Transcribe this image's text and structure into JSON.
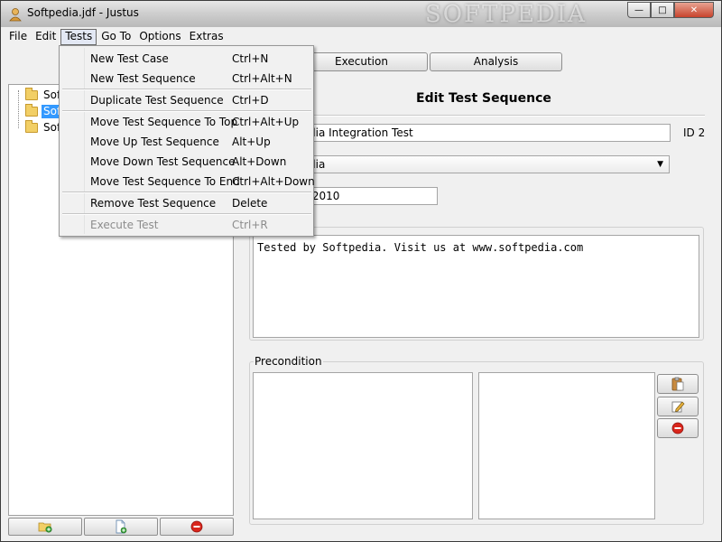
{
  "window": {
    "title": "Softpedia.jdf - Justus",
    "watermark": "SOFTPEDIA",
    "controls": {
      "minimize": "—",
      "maximize": "□",
      "close": "✕"
    }
  },
  "menubar": {
    "items": [
      "File",
      "Edit",
      "Tests",
      "Go To",
      "Options",
      "Extras"
    ],
    "active": "Tests"
  },
  "tests_menu": {
    "items": [
      {
        "label": "New Test Case",
        "shortcut": "Ctrl+N",
        "enabled": true
      },
      {
        "label": "New Test Sequence",
        "shortcut": "Ctrl+Alt+N",
        "enabled": true
      },
      {
        "label": "Duplicate Test Sequence",
        "shortcut": "Ctrl+D",
        "enabled": true
      },
      {
        "label": "Move Test Sequence To Top",
        "shortcut": "Ctrl+Alt+Up",
        "enabled": true
      },
      {
        "label": "Move Up Test Sequence",
        "shortcut": "Alt+Up",
        "enabled": true
      },
      {
        "label": "Move Down Test Sequence",
        "shortcut": "Alt+Down",
        "enabled": true
      },
      {
        "label": "Move Test Sequence To End",
        "shortcut": "Ctrl+Alt+Down",
        "enabled": true
      },
      {
        "label": "Remove Test Sequence",
        "shortcut": "Delete",
        "enabled": true
      },
      {
        "label": "Execute Test",
        "shortcut": "Ctrl+R",
        "enabled": false
      }
    ]
  },
  "tree": {
    "items": [
      {
        "label": "Sof",
        "selected": false
      },
      {
        "label": "Sof",
        "selected": true
      },
      {
        "label": "Sof",
        "selected": false
      }
    ]
  },
  "tabs": {
    "execution": "Execution",
    "analysis": "Analysis"
  },
  "editor": {
    "heading": "Edit Test Sequence",
    "name_value": "dia Integration Test",
    "id_label": "ID 2",
    "category_value": "dia",
    "date_value": ".2010",
    "description": "Tested by Softpedia. Visit us at www.softpedia.com",
    "precondition_label": "Precondition"
  },
  "icons": {
    "app": "person-icon",
    "add_folder": "add-folder-icon",
    "add_file": "add-file-icon",
    "remove": "remove-icon",
    "paste": "paste-icon",
    "edit": "edit-icon"
  },
  "colors": {
    "selection": "#3399ff",
    "remove_red": "#d9261c"
  }
}
